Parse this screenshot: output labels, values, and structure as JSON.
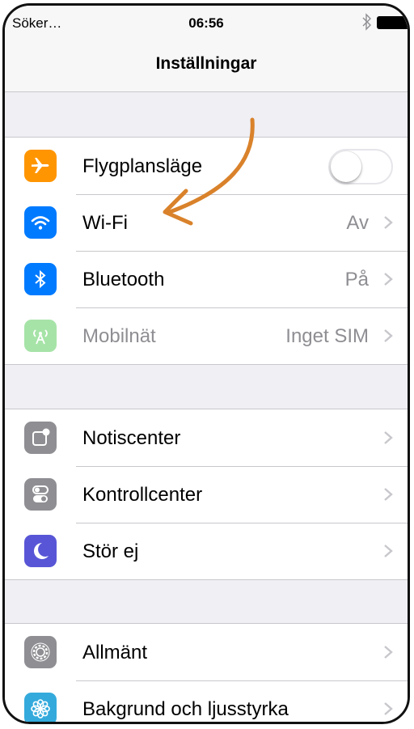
{
  "status_bar": {
    "carrier": "Söker…",
    "time": "06:56"
  },
  "nav": {
    "title": "Inställningar"
  },
  "groups": [
    {
      "rows": [
        {
          "label": "Flygplansläge",
          "icon": "airplane-icon",
          "icon_color": "#ff9500",
          "control": "toggle",
          "toggle_on": false
        },
        {
          "label": "Wi-Fi",
          "value": "Av",
          "icon": "wifi-icon",
          "icon_color": "#007aff"
        },
        {
          "label": "Bluetooth",
          "value": "På",
          "icon": "bluetooth-icon",
          "icon_color": "#007aff"
        },
        {
          "label": "Mobilnät",
          "value": "Inget SIM",
          "icon": "cellular-icon",
          "icon_color": "#a6e3a7",
          "disabled": true
        }
      ]
    },
    {
      "rows": [
        {
          "label": "Notiscenter",
          "icon": "notification-center-icon",
          "icon_color": "#8e8e93"
        },
        {
          "label": "Kontrollcenter",
          "icon": "control-center-icon",
          "icon_color": "#8e8e93"
        },
        {
          "label": "Stör ej",
          "icon": "moon-icon",
          "icon_color": "#5856d6"
        }
      ]
    },
    {
      "rows": [
        {
          "label": "Allmänt",
          "icon": "gear-icon",
          "icon_color": "#8e8e93"
        },
        {
          "label": "Bakgrund och ljusstyrka",
          "icon": "flower-icon",
          "icon_color": "#34aadc"
        }
      ]
    }
  ],
  "annotation_color": "#d9822b"
}
